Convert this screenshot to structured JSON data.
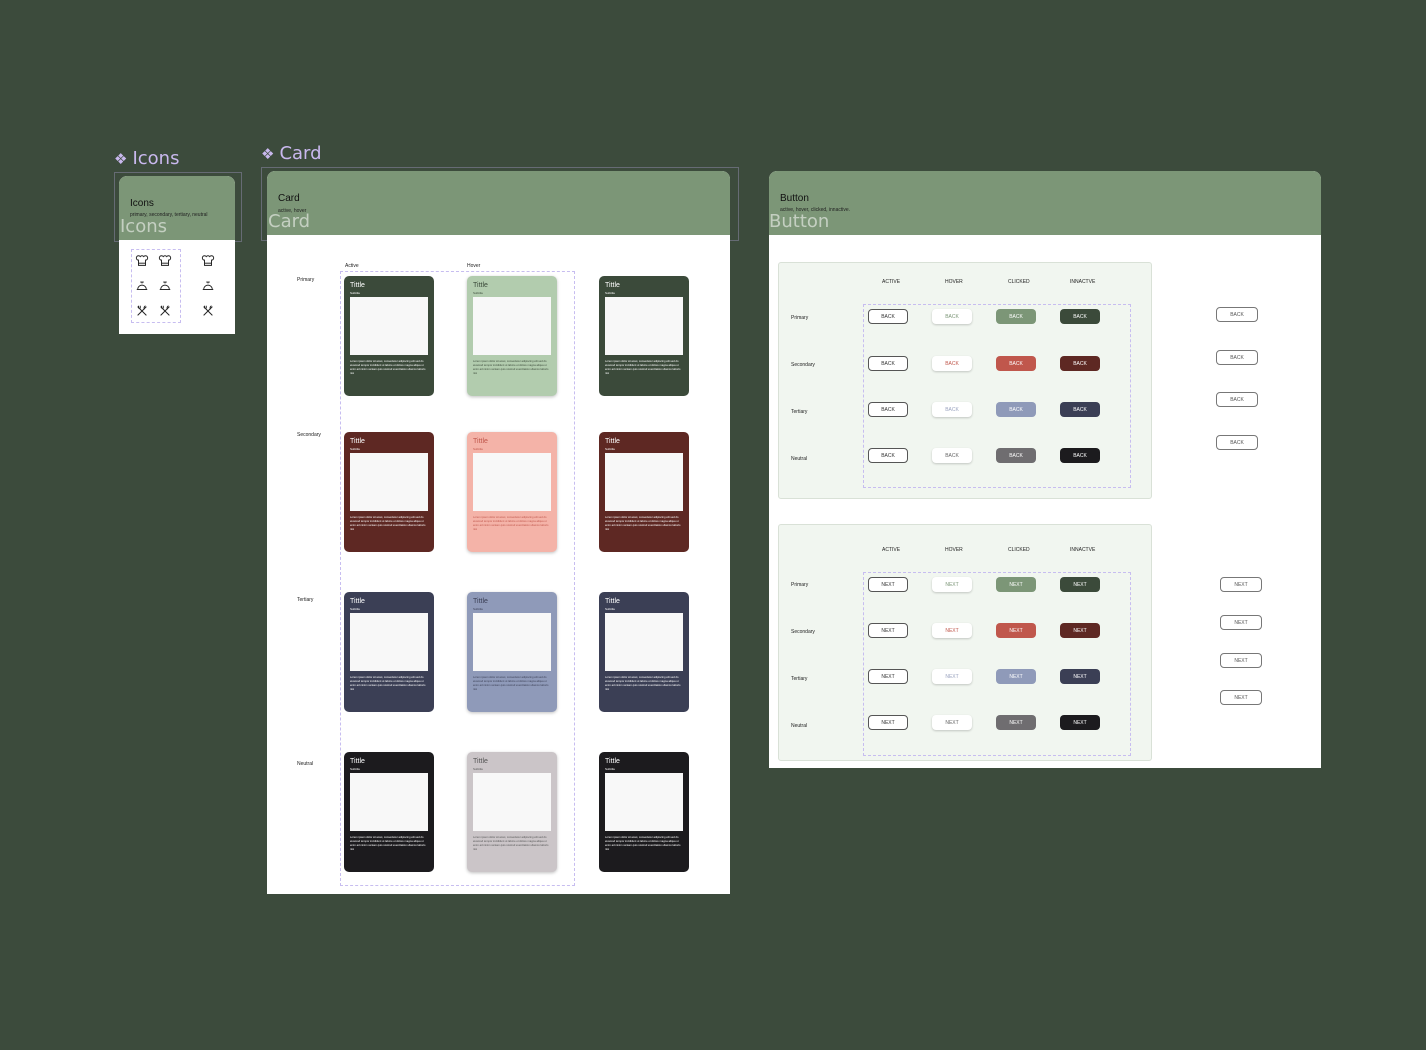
{
  "icons_component": {
    "label": "Icons",
    "title": "Icons",
    "subtitle": "primary, secondary, tertiary, neutral",
    "ghost_label": "Icons",
    "icon_names": [
      "chef-hat-icon",
      "chef-hat-icon",
      "chef-hat-icon",
      "serving-dish-icon",
      "serving-dish-icon",
      "serving-dish-icon",
      "utensils-icon",
      "utensils-icon",
      "utensils-icon"
    ]
  },
  "card_component": {
    "label": "Card",
    "title": "Card",
    "subtitle": "active, hover",
    "ghost_label": "Card",
    "columns": [
      "Active",
      "Hover"
    ],
    "rows": [
      "Primary",
      "Secondary",
      "Tertiary",
      "Neutral"
    ],
    "card_title": "Tittle",
    "card_subtitle": "Subtitle",
    "card_text": "Lorem ipsum dolor sit amet, consectetur adipiscing elit sed do eiusmod tempor incididunt ut labore et dolore magna aliqua ut enim ad minim veniam quis nostrud exercitation ullamco laboris nisi",
    "colors": {
      "primary": {
        "active": "#3b4a3a",
        "hover": "#b2ccae",
        "hover_text": "#3b4a3a"
      },
      "secondary": {
        "active": "#5e2823",
        "hover": "#f4b3a8",
        "hover_text": "#c0574c"
      },
      "tertiary": {
        "active": "#3b3f55",
        "hover": "#8f9ab9",
        "hover_text": "#3b3f55"
      },
      "neutral": {
        "active": "#1c1b1e",
        "hover": "#cbc5c8",
        "hover_text": "#555"
      }
    }
  },
  "button_component": {
    "title": "Button",
    "subtitle": "active, hover, clicked, innactive.",
    "ghost_label": "Button",
    "states": [
      "ACTIVE",
      "HOVER",
      "CLICKED",
      "INNACTVE"
    ],
    "rows": [
      "Primary",
      "Secondary",
      "Tertiary",
      "Neutral"
    ],
    "back_label": "BACK",
    "next_label": "NEXT",
    "colors": {
      "primary": {
        "clicked": "#7c9677",
        "inactive": "#3b4a3a",
        "hover_text": "#7c9677"
      },
      "secondary": {
        "clicked": "#c0574c",
        "inactive": "#5e2823",
        "hover_text": "#c0574c"
      },
      "tertiary": {
        "clicked": "#8f9ab9",
        "inactive": "#3b3f55",
        "hover_text": "#9aa3bf"
      },
      "neutral": {
        "clicked": "#6f6d70",
        "inactive": "#1c1b1e",
        "hover_text": "#666"
      }
    }
  }
}
